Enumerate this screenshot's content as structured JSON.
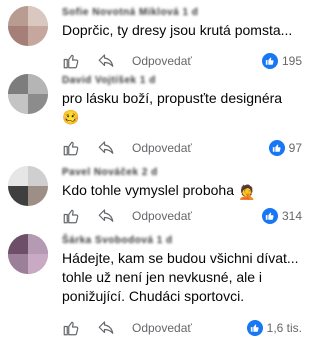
{
  "comments": [
    {
      "author": "Sofie Novotná Miklová 1 d",
      "text": "Doprčic, ty dresy jsou krutá pomsta...",
      "emoji": "",
      "reply_label": "Odpovedať",
      "likes": "195"
    },
    {
      "author": "David Vojtíšek 1 d",
      "text": "pro lásku boží, propusťte designéra",
      "emoji": "🥴",
      "reply_label": "Odpovedať",
      "likes": "97"
    },
    {
      "author": "Pavel Nováček 2 d",
      "text": "Kdo tohle vymyslel proboha",
      "emoji": "🤦",
      "reply_label": "Odpovedať",
      "likes": "314"
    },
    {
      "author": "Šárka Svobodová 1 d",
      "text": "Hádejte, kam se budou všichni dívat... tohle už není jen nevkusné, ale i ponižující. Chudáci sportovci.",
      "emoji": "",
      "reply_label": "Odpovedať",
      "likes": "1,6 tis."
    }
  ],
  "icons": {
    "like": "thumbs-up-outline-icon",
    "reply": "reply-arrow-icon",
    "reaction": "like-reaction-icon"
  },
  "colors": {
    "reaction_blue": "#1877f2",
    "secondary_text": "#65676b"
  }
}
